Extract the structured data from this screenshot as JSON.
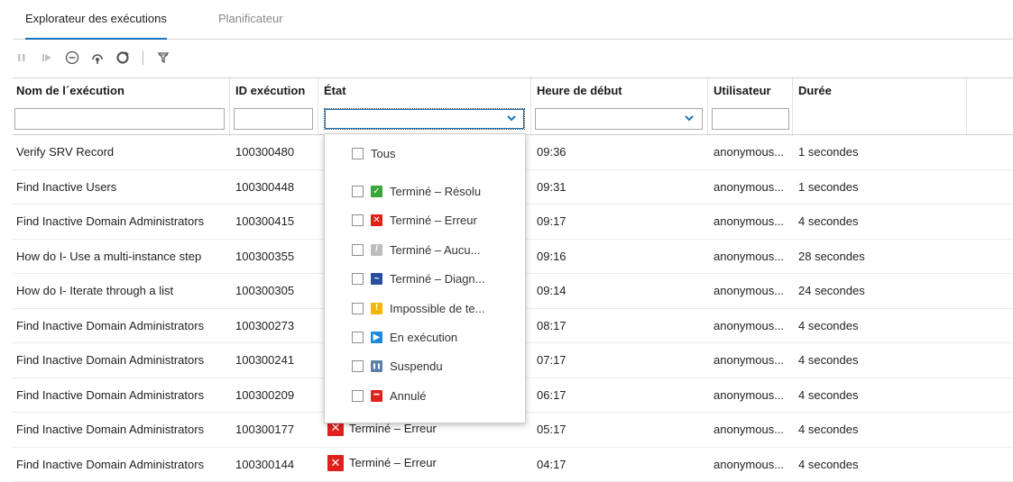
{
  "tabs": [
    {
      "label": "Explorateur des exécutions",
      "active": true
    },
    {
      "label": "Planificateur",
      "active": false
    }
  ],
  "toolbar": {
    "icons": [
      "pause-icon",
      "resume-icon",
      "cancel-icon",
      "reassign-icon",
      "refresh-icon",
      "filter-icon"
    ]
  },
  "columns": {
    "name": "Nom de l´exécution",
    "id": "ID exécution",
    "state": "État",
    "start": "Heure de début",
    "user": "Utilisateur",
    "duration": "Durée"
  },
  "rows": [
    {
      "name": "Verify SRV Record",
      "id": "100300480",
      "state": "",
      "start": "09:36",
      "user": "anonymous...",
      "duration": "1 secondes"
    },
    {
      "name": "Find Inactive Users",
      "id": "100300448",
      "state": "",
      "start": "09:31",
      "user": "anonymous...",
      "duration": "1 secondes"
    },
    {
      "name": "Find Inactive Domain Administrators",
      "id": "100300415",
      "state": "",
      "start": "09:17",
      "user": "anonymous...",
      "duration": "4 secondes"
    },
    {
      "name": "How do I- Use a multi-instance step",
      "id": "100300355",
      "state": "",
      "start": "09:16",
      "user": "anonymous...",
      "duration": "28 secondes"
    },
    {
      "name": "How do I- Iterate through a list",
      "id": "100300305",
      "state": "",
      "start": "09:14",
      "user": "anonymous...",
      "duration": "24 secondes"
    },
    {
      "name": "Find Inactive Domain Administrators",
      "id": "100300273",
      "state": "",
      "start": "08:17",
      "user": "anonymous...",
      "duration": "4 secondes"
    },
    {
      "name": "Find Inactive Domain Administrators",
      "id": "100300241",
      "state": "",
      "start": "07:17",
      "user": "anonymous...",
      "duration": "4 secondes"
    },
    {
      "name": "Find Inactive Domain Administrators",
      "id": "100300209",
      "state": "",
      "start": "06:17",
      "user": "anonymous...",
      "duration": "4 secondes"
    },
    {
      "name": "Find Inactive Domain Administrators",
      "id": "100300177",
      "state": "Terminé – Erreur",
      "start": "05:17",
      "user": "anonymous...",
      "duration": "4 secondes"
    },
    {
      "name": "Find Inactive Domain Administrators",
      "id": "100300144",
      "state": "Terminé – Erreur",
      "start": "04:17",
      "user": "anonymous...",
      "duration": "4 secondes"
    }
  ],
  "state_filter": {
    "all": "Tous",
    "options": [
      {
        "label": "Terminé – Résolu",
        "icon": "resolved-icon",
        "color": "#3aa53a"
      },
      {
        "label": "Terminé – Erreur",
        "icon": "error-icon",
        "color": "#e0211b"
      },
      {
        "label": "Terminé – Aucu...",
        "icon": "no-action-icon",
        "color": "#bdbdbd"
      },
      {
        "label": "Terminé – Diagn...",
        "icon": "diagnosed-icon",
        "color": "#2a4f9c"
      },
      {
        "label": "Impossible de te...",
        "icon": "warning-icon",
        "color": "#f2b705"
      },
      {
        "label": "En exécution",
        "icon": "running-icon",
        "color": "#1c8ad6"
      },
      {
        "label": "Suspendu",
        "icon": "paused-icon",
        "color": "#5e7fa8"
      },
      {
        "label": "Annulé",
        "icon": "cancelled-icon",
        "color": "#e0211b"
      }
    ]
  }
}
